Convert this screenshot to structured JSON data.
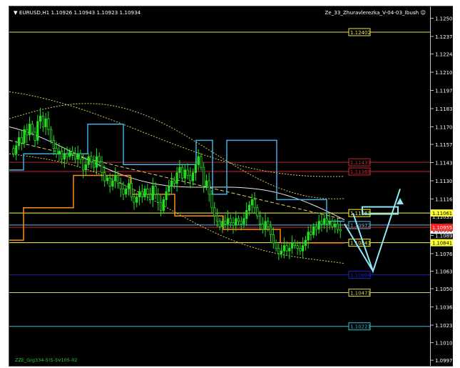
{
  "header": {
    "symbol_info": "EURUSD,H1  1.10926 1.10943 1.10923 1.10934",
    "indicator_name": "Ze_33_Zhuravlerezka_V-04-03_Ibush"
  },
  "footer": {
    "label": "ZZE_Grg334-5!5-5V105-02"
  },
  "chart_data": {
    "type": "line",
    "title": "",
    "xlabel": "",
    "ylabel": "",
    "ylim": [
      1.0996,
      1.1255
    ],
    "y_ticks": [
      1.12505,
      1.1237,
      1.1224,
      1.12105,
      1.1197,
      1.11835,
      1.117,
      1.1157,
      1.11435,
      1.113,
      1.11165,
      1.1103,
      1.10895,
      1.1076,
      1.1063,
      1.105,
      1.10365,
      1.1023,
      1.101,
      1.0997
    ],
    "y_tick_labels": [
      "1.12505",
      "1.12370",
      "1.12240",
      "1.12105",
      "1.11970",
      "1.11835",
      "1.11700",
      "1.11570",
      "1.11435",
      "1.11300",
      "1.11165",
      "1.11030",
      "1.10895",
      "1.10760",
      "1.10630",
      "1.10500",
      "1.10365",
      "1.10230",
      "1.10100",
      "1.09970"
    ],
    "price_tags": [
      {
        "value": 1.10934,
        "label": "1.10934",
        "bg": "#ffffff",
        "fg": "#000000"
      },
      {
        "value": 1.10955,
        "label": "1.10955",
        "bg": "#ff2020",
        "fg": "#ffffff"
      },
      {
        "value": 1.11035,
        "label": "1.11035",
        "bg": "#000000",
        "fg": "#ffffff"
      },
      {
        "value": 1.11061,
        "label": "1.11061",
        "bg": "#ffff30",
        "fg": "#000000"
      },
      {
        "value": 1.10841,
        "label": "1.10841",
        "bg": "#ffff30",
        "fg": "#000000"
      }
    ],
    "levels": [
      {
        "value": 1.12402,
        "label": "1.12402",
        "color": "#e8e04a"
      },
      {
        "value": 1.11437,
        "label": "1.11437",
        "color": "#b03030"
      },
      {
        "value": 1.11369,
        "label": "1.11369",
        "color": "#d02828"
      },
      {
        "value": 1.11061,
        "label": "1.11061",
        "color": "#ffff30"
      },
      {
        "value": 1.10972,
        "label": "1.10972",
        "color": "#4fc3e8"
      },
      {
        "value": 1.10955,
        "label": "",
        "color": "#d02020"
      },
      {
        "value": 1.10841,
        "label": "1.10841",
        "color": "#ffff30"
      },
      {
        "value": 1.10604,
        "label": "1.10604",
        "color": "#2020c0"
      },
      {
        "value": 1.10471,
        "label": "1.10471",
        "color": "#d8d050"
      },
      {
        "value": 1.10221,
        "label": "1.10221",
        "color": "#30c0d0"
      }
    ],
    "candle_closes": [
      1.115,
      1.1156,
      1.1162,
      1.1158,
      1.1168,
      1.1164,
      1.1172,
      1.1166,
      1.116,
      1.1174,
      1.1178,
      1.117,
      1.1176,
      1.1168,
      1.116,
      1.1154,
      1.115,
      1.1152,
      1.1146,
      1.115,
      1.1148,
      1.1152,
      1.115,
      1.1146,
      1.115,
      1.1146,
      1.1138,
      1.1142,
      1.1148,
      1.1144,
      1.114,
      1.1148,
      1.1144,
      1.1136,
      1.113,
      1.1132,
      1.1126,
      1.113,
      1.1134,
      1.1128,
      1.1124,
      1.112,
      1.1124,
      1.1128,
      1.1118,
      1.1114,
      1.1118,
      1.1122,
      1.1118,
      1.1124,
      1.112,
      1.1116,
      1.1126,
      1.112,
      1.1114,
      1.1108,
      1.1116,
      1.1122,
      1.1126,
      1.113,
      1.1128,
      1.1136,
      1.114,
      1.1132,
      1.1138,
      1.1134,
      1.113,
      1.1136,
      1.1142,
      1.1148,
      1.114,
      1.1126,
      1.113,
      1.112,
      1.111,
      1.1104,
      1.11,
      1.1096,
      1.11,
      1.1098,
      1.1102,
      1.1099,
      1.1097,
      1.1102,
      1.11,
      1.1098,
      1.1102,
      1.1108,
      1.1112,
      1.1116,
      1.111,
      1.1104,
      1.1098,
      1.1094,
      1.11,
      1.1096,
      1.109,
      1.1084,
      1.108,
      1.1076,
      1.1078,
      1.1082,
      1.1078,
      1.108,
      1.1084,
      1.1082,
      1.108,
      1.1078,
      1.1082,
      1.1086,
      1.1092,
      1.109,
      1.1096,
      1.1094,
      1.11,
      1.1098,
      1.1102,
      1.1098,
      1.11,
      1.1096,
      1.1098,
      1.1094,
      1.1093
    ],
    "zigzag_projection": [
      [
        1.1106,
        1.1063
      ],
      [
        1.1063,
        1.1106
      ],
      [
        1.1063,
        1.1094
      ],
      [
        1.1094,
        1.1063
      ],
      [
        1.1063,
        1.1124
      ]
    ]
  }
}
